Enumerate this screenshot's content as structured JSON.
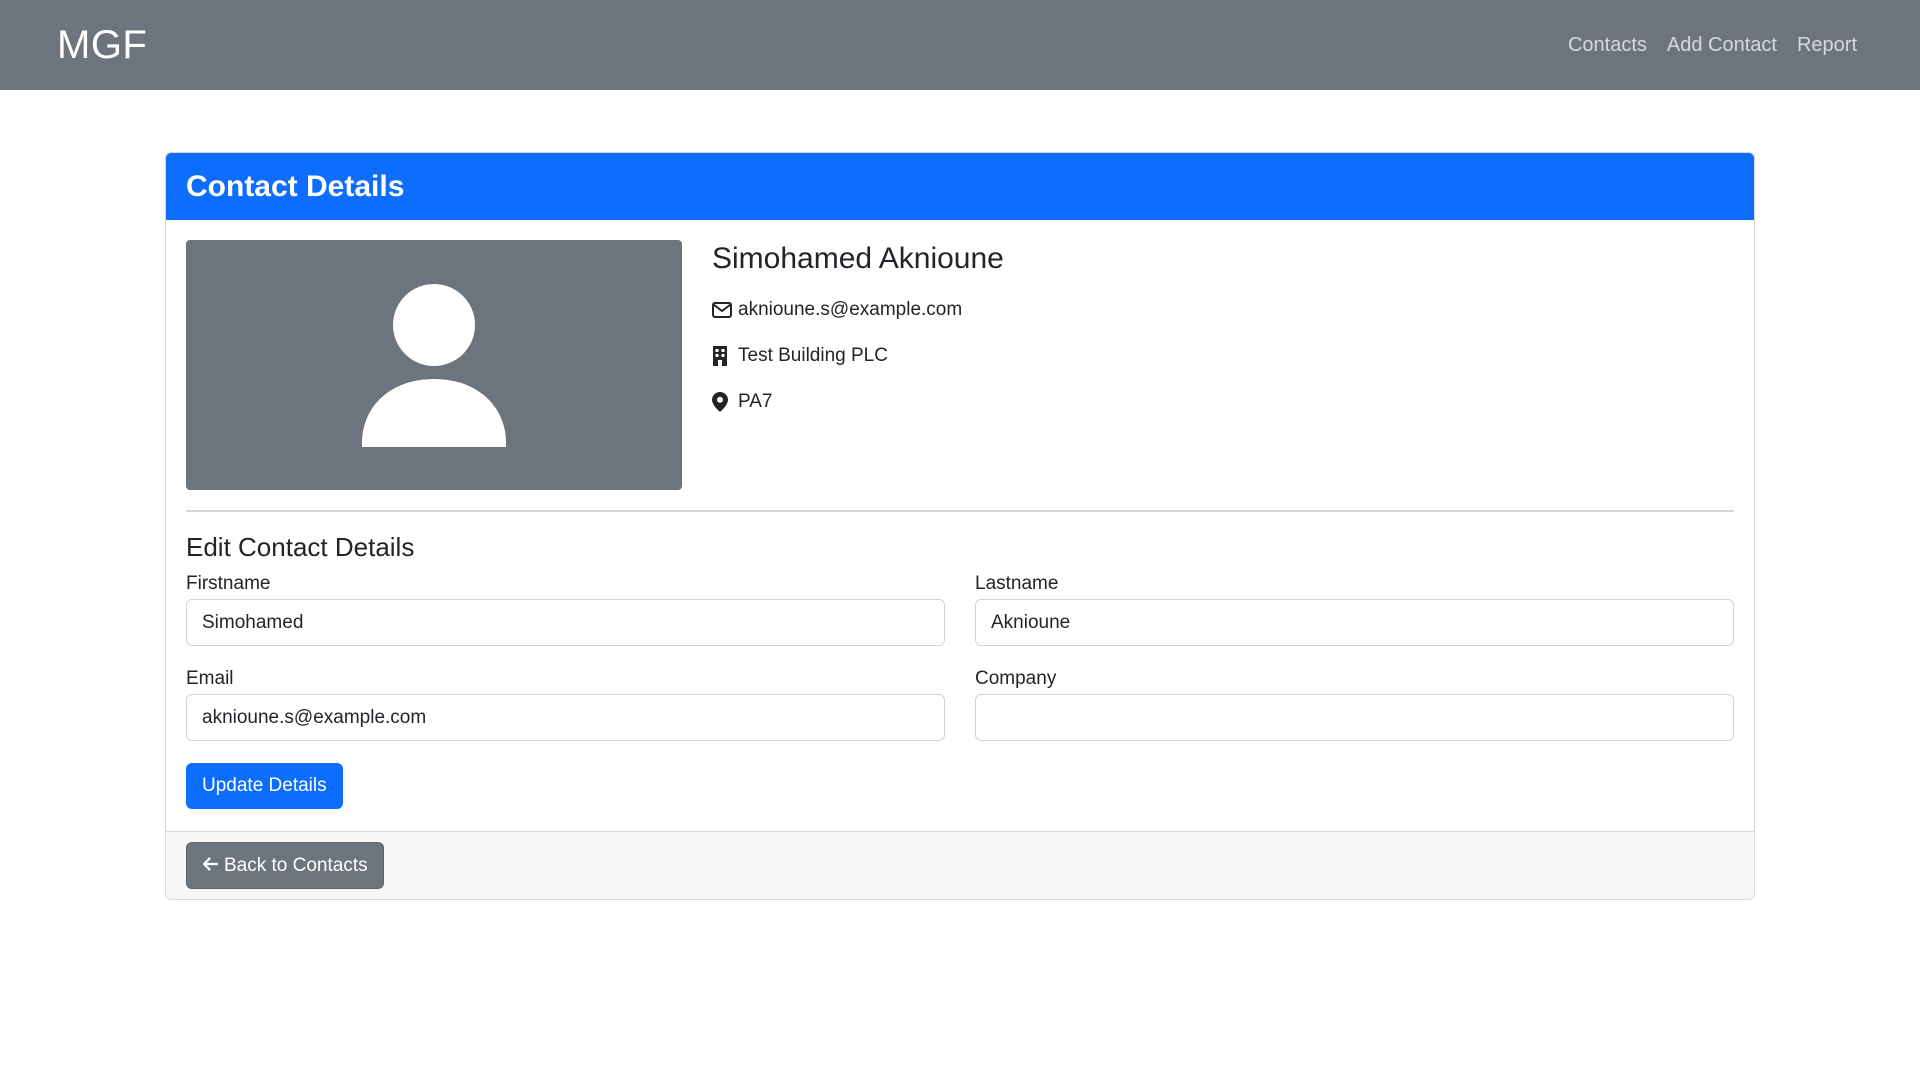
{
  "navbar": {
    "brand": "MGF",
    "links": [
      {
        "label": "Contacts"
      },
      {
        "label": "Add Contact"
      },
      {
        "label": "Report"
      }
    ]
  },
  "card": {
    "header_title": "Contact Details",
    "avatar_icon": "person-icon",
    "contact": {
      "name": "Simohamed Aknioune",
      "email": "aknioune.s@example.com",
      "company": "Test Building PLC",
      "location": "PA7",
      "icons": {
        "email": "envelope-icon",
        "company": "building-icon",
        "location": "map-pin-icon"
      }
    },
    "edit_section": {
      "title": "Edit Contact Details",
      "fields": {
        "firstname": {
          "label": "Firstname",
          "value": "Simohamed"
        },
        "lastname": {
          "label": "Lastname",
          "value": "Aknioune"
        },
        "email": {
          "label": "Email",
          "value": "aknioune.s@example.com"
        },
        "company": {
          "label": "Company",
          "value": ""
        }
      },
      "submit_label": "Update Details"
    },
    "footer": {
      "back_label": "Back to Contacts",
      "back_icon": "arrow-left-icon"
    }
  },
  "colors": {
    "navbar_bg": "#6c757d",
    "primary": "#0d6efd",
    "secondary": "#6c757d"
  }
}
